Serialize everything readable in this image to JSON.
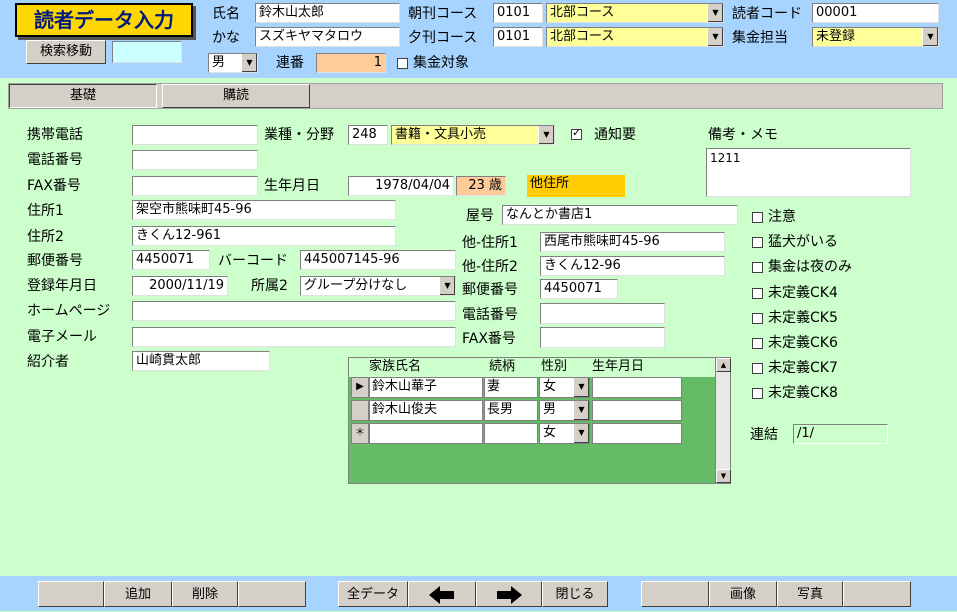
{
  "header": {
    "title": "読者データ入力",
    "search_move": "検索移動",
    "search_value": "",
    "name_label": "氏名",
    "name_value": "鈴木山太郎",
    "kana_label": "かな",
    "kana_value": "スズキヤマタロウ",
    "gender_value": "男",
    "serial_label": "連番",
    "serial_value": "1",
    "collect_target_label": "集金対象",
    "morning_label": "朝刊コース",
    "morning_code": "0101",
    "morning_course": "北部コース",
    "evening_label": "夕刊コース",
    "evening_code": "0101",
    "evening_course": "北部コース",
    "reader_code_label": "読者コード",
    "reader_code_value": "00001",
    "collector_label": "集金担当",
    "collector_value": "未登録"
  },
  "tabs": [
    "基礎",
    "購読"
  ],
  "form": {
    "mobile_label": "携帯電話",
    "mobile_value": "",
    "phone_label": "電話番号",
    "phone_value": "",
    "fax_label": "FAX番号",
    "fax_value": "",
    "industry_label": "業種・分野",
    "industry_code": "248",
    "industry_value": "書籍・文具小売",
    "notify_label": "通知要",
    "birth_label": "生年月日",
    "birth_value": "1978/04/04",
    "age_value": "23 歳",
    "other_address_badge": "他住所",
    "memo_label": "備考・メモ",
    "memo_value": "1211",
    "address1_label": "住所1",
    "address1_value": "架空市熊味町45-96",
    "address2_label": "住所2",
    "address2_value": "きくん12-961",
    "shop_label": "屋号",
    "shop_value": "なんとか書店1",
    "postal_label": "郵便番号",
    "postal_value": "4450071",
    "barcode_label": "バーコード",
    "barcode_value": "445007145-96",
    "other_address1_label": "他-住所1",
    "other_address1_value": "西尾市熊味町45-96",
    "other_address2_label": "他-住所2",
    "other_address2_value": "きくん12-96",
    "register_label": "登録年月日",
    "register_value": "2000/11/19",
    "group_label": "所属2",
    "group_value": "グループ分けなし",
    "other_postal_label": "郵便番号",
    "other_postal_value": "4450071",
    "homepage_label": "ホームページ",
    "homepage_value": "",
    "other_phone_label": "電話番号",
    "other_phone_value": "",
    "email_label": "電子メール",
    "email_value": "",
    "other_fax_label": "FAX番号",
    "other_fax_value": "",
    "introducer_label": "紹介者",
    "introducer_value": "山崎貫太郎",
    "renketsu_label": "連結",
    "renketsu_value": "/1/"
  },
  "checkboxes": [
    {
      "label": "注意",
      "checked": false
    },
    {
      "label": "猛犬がいる",
      "checked": false
    },
    {
      "label": "集金は夜のみ",
      "checked": false
    },
    {
      "label": "未定義CK4",
      "checked": false
    },
    {
      "label": "未定義CK5",
      "checked": false
    },
    {
      "label": "未定義CK6",
      "checked": false
    },
    {
      "label": "未定義CK7",
      "checked": false
    },
    {
      "label": "未定義CK8",
      "checked": false
    }
  ],
  "family": {
    "headers": [
      "家族氏名",
      "続柄",
      "性別",
      "生年月日"
    ],
    "rows": [
      {
        "selector": "▶",
        "name": "鈴木山華子",
        "relation": "妻",
        "gender": "女",
        "birth": ""
      },
      {
        "selector": "",
        "name": "鈴木山俊夫",
        "relation": "長男",
        "gender": "男",
        "birth": ""
      },
      {
        "selector": "＊",
        "name": "",
        "relation": "",
        "gender": "女",
        "birth": ""
      }
    ]
  },
  "footer": {
    "add": "追加",
    "delete": "削除",
    "all_data": "全データ",
    "close": "閉じる",
    "image": "画像",
    "photo": "写真"
  }
}
